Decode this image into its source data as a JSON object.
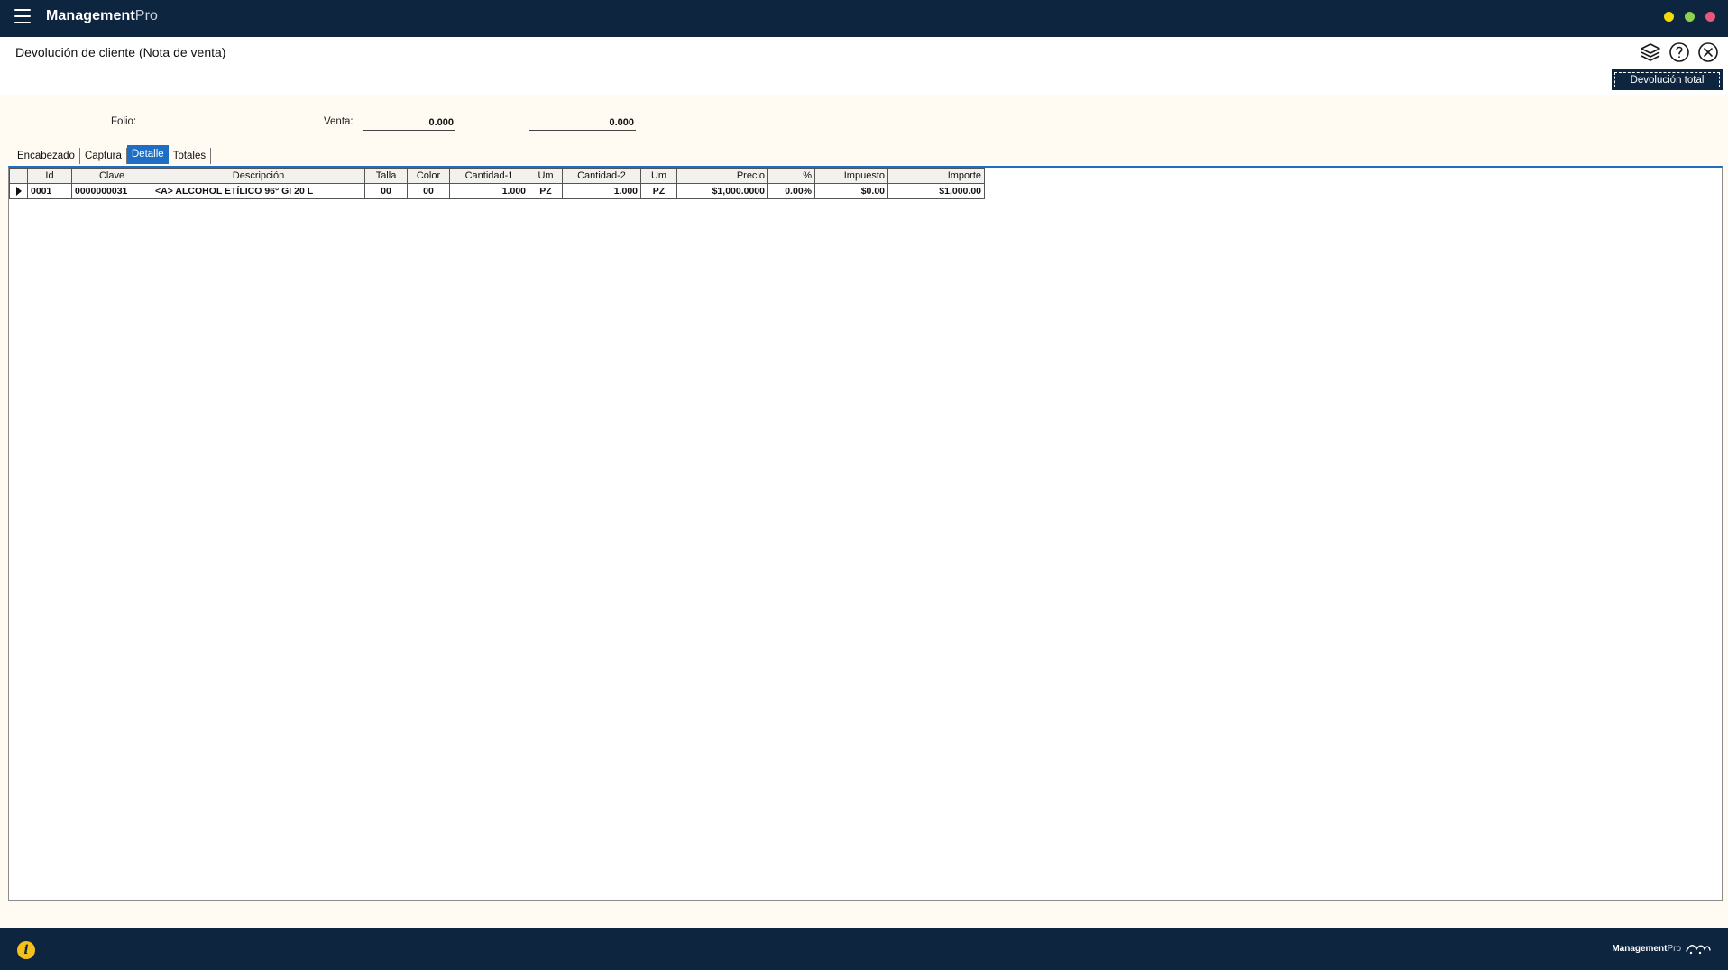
{
  "titlebar": {
    "app_name": "Management",
    "app_suffix": "Pro",
    "dot_colors": [
      "#f5d90a",
      "#8fd14f",
      "#e8577a"
    ]
  },
  "header": {
    "title": "Devolución de cliente (Nota de venta)",
    "icons": [
      "layers-icon",
      "help-icon",
      "close-icon"
    ],
    "total_button": "Devolución total"
  },
  "fields": {
    "folio_label": "Folio:",
    "venta_label": "Venta:",
    "venta_value": "0.000",
    "venta_value2": "0.000"
  },
  "tabs": [
    {
      "label": "Encabezado",
      "active": false
    },
    {
      "label": "Captura",
      "active": false
    },
    {
      "label": "Detalle",
      "active": true
    },
    {
      "label": "Totales",
      "active": false
    }
  ],
  "grid": {
    "columns": [
      "",
      "Id",
      "Clave",
      "Descripción",
      "Talla",
      "Color",
      "Cantidad-1",
      "Um",
      "Cantidad-2",
      "Um",
      "Precio",
      "%",
      "Impuesto",
      "Importe"
    ],
    "rows": [
      [
        "",
        "0001",
        "0000000031",
        "<A> ALCOHOL ETÍLICO 96° GI 20 L",
        "00",
        "00",
        "1.000",
        "PZ",
        "1.000",
        "PZ",
        "$1,000.0000",
        "0.00%",
        "$0.00",
        "$1,000.00"
      ]
    ]
  },
  "footer": {
    "info_icon": "info-icon",
    "brand": "Management",
    "brand_suffix": "Pro"
  }
}
